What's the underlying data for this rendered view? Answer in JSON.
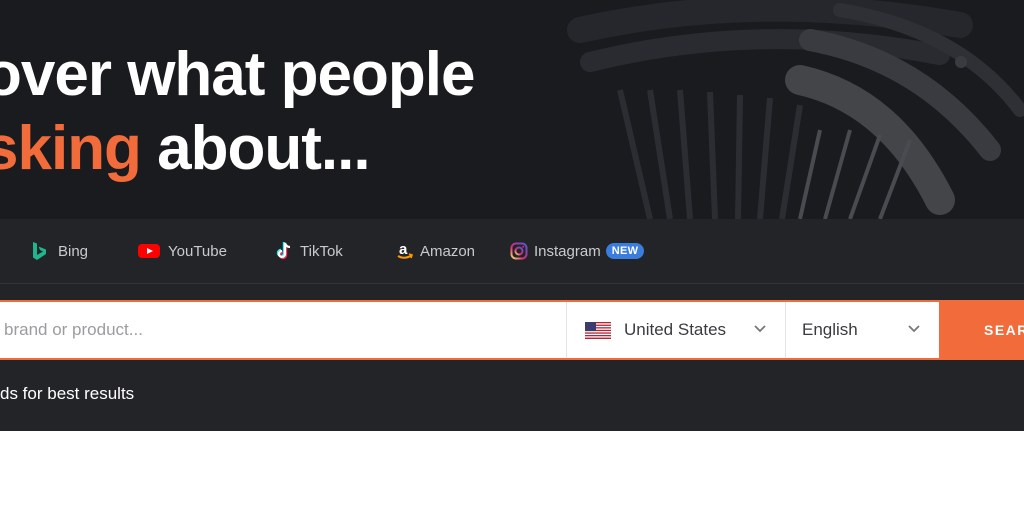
{
  "hero": {
    "line1": "over what people",
    "line2_accent": "sking",
    "line2_rest": " about..."
  },
  "tabs": [
    {
      "label": "Bing",
      "icon": "bing-icon"
    },
    {
      "label": "YouTube",
      "icon": "youtube-icon"
    },
    {
      "label": "TikTok",
      "icon": "tiktok-icon"
    },
    {
      "label": "Amazon",
      "icon": "amazon-icon"
    },
    {
      "label": "Instagram",
      "icon": "instagram-icon",
      "badge": "NEW"
    }
  ],
  "search": {
    "placeholder": "brand or product...",
    "value": "",
    "country": "United States",
    "country_flag": "us-flag-icon",
    "language": "English",
    "button_label": "SEARCH"
  },
  "hint": "ds for best results",
  "colors": {
    "accent": "#f26b3a",
    "hero_bg": "#1a1b1f",
    "panel_bg": "#232428",
    "badge": "#3b7ddd"
  }
}
